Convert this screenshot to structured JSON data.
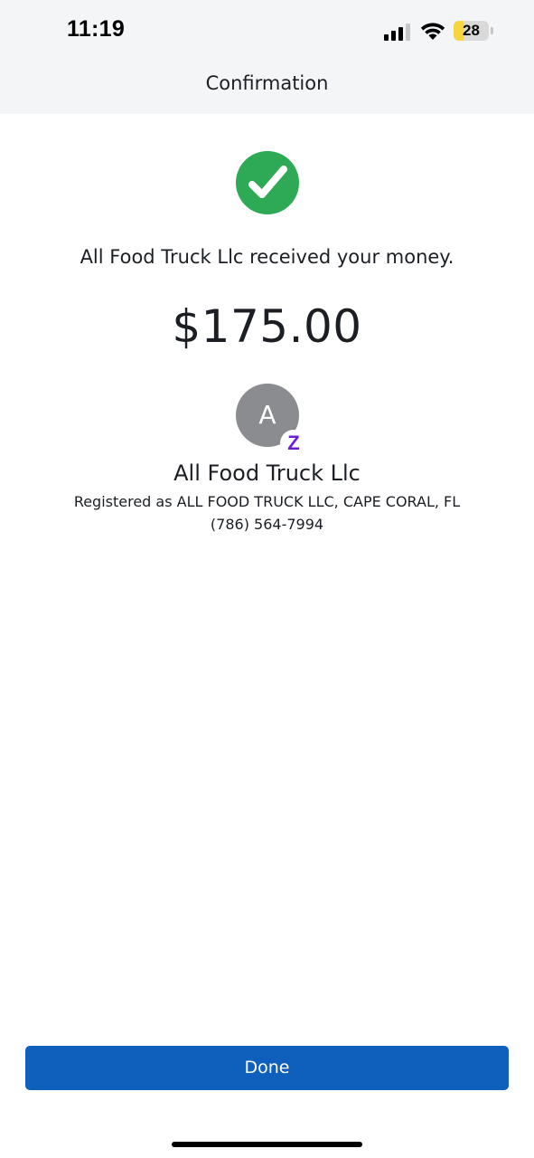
{
  "status_bar": {
    "time": "11:19",
    "battery_level": "28",
    "battery_fraction": 0.28,
    "icons": [
      "cellular-signal-icon",
      "wifi-icon",
      "battery-icon"
    ]
  },
  "header": {
    "title": "Confirmation"
  },
  "confirmation": {
    "icon": "checkmark-circle-icon",
    "success_color": "#2eaa56",
    "message": "All Food Truck Llc received your money.",
    "amount": "$175.00"
  },
  "recipient": {
    "avatar_initial": "A",
    "avatar_color": "#8a8c8f",
    "badge_icon": "zelle-icon",
    "badge_glyph": "Z",
    "badge_color": "#6d1ed4",
    "name": "All Food Truck Llc",
    "registered_as": "Registered as ALL FOOD TRUCK LLC, CAPE CORAL, FL",
    "phone": "(786) 564-7994"
  },
  "footer": {
    "done_label": "Done",
    "button_color": "#0f5fbc"
  }
}
